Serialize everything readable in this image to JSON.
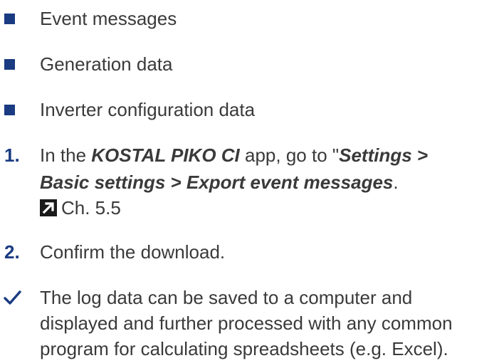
{
  "bullets": [
    "Event messages",
    "Generation data",
    "Inverter configuration data"
  ],
  "steps": [
    {
      "number": "1.",
      "line1_prefix": "In the ",
      "line1_app": "KOSTAL PIKO CI",
      "line1_suffix": " app, go to \"",
      "line1_path_start": "Settings >",
      "line2_path": "Basic settings > Export event messages",
      "line2_end": ".",
      "xref_text": "Ch. 5.5"
    },
    {
      "number": "2.",
      "text": "Confirm the download."
    }
  ],
  "result": {
    "lines": [
      "The log data can be saved to a computer and",
      "displayed and further processed with any common",
      "program for calculating spreadsheets (e.g. Excel)."
    ]
  },
  "colors": {
    "accent": "#1a3b82",
    "text": "#3a3a3a",
    "icon_dark": "#1a1a1a"
  },
  "icons": {
    "bullet": "square-bullet-icon",
    "xref": "cross-reference-arrow-icon",
    "result": "checkmark-icon"
  }
}
